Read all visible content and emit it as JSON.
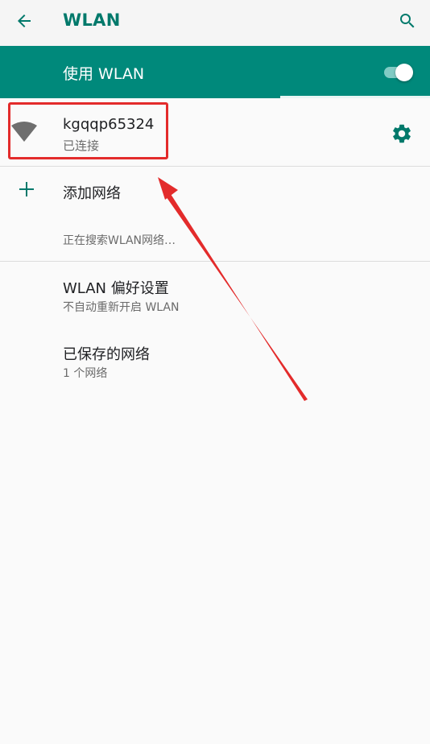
{
  "appbar": {
    "title": "WLAN",
    "back_icon": "arrow-left-icon",
    "search_icon": "search-icon"
  },
  "master_switch": {
    "label": "使用 WLAN",
    "enabled": true
  },
  "connected_network": {
    "ssid": "kgqqp65324",
    "status": "已连接",
    "signal_icon": "wifi-icon",
    "settings_icon": "gear-icon"
  },
  "add_network": {
    "label": "添加网络",
    "icon": "plus-icon"
  },
  "scan_status": "正在搜索WLAN网络…",
  "preferences": {
    "title": "WLAN 偏好设置",
    "subtitle": "不自动重新开启 WLAN"
  },
  "saved_networks": {
    "title": "已保存的网络",
    "subtitle": "1 个网络"
  },
  "colors": {
    "accent": "#00897b",
    "title_accent": "#00796b",
    "annotation": "#e32b2b"
  }
}
